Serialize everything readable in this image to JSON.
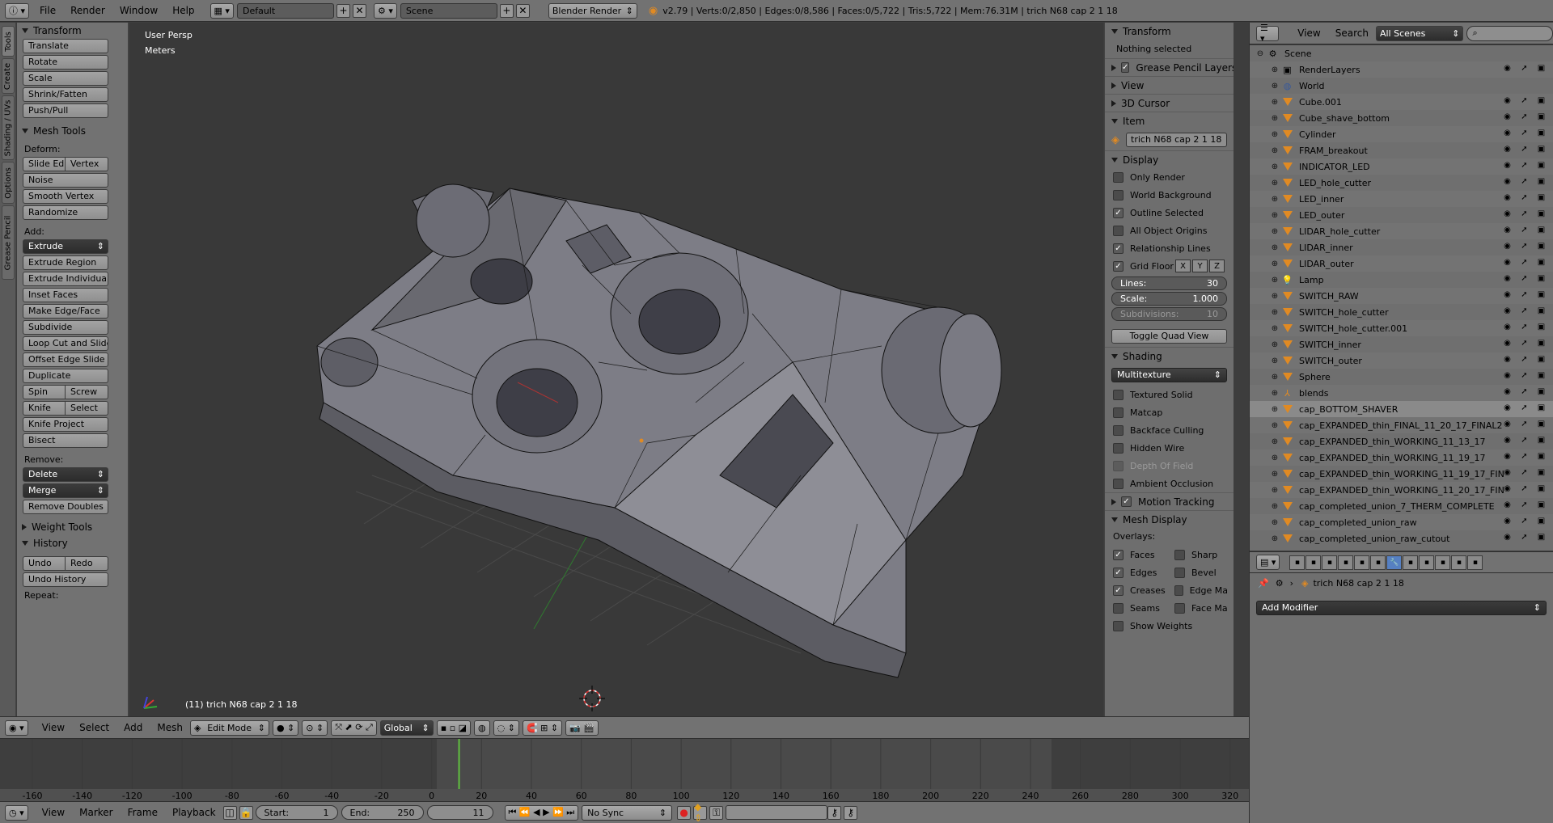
{
  "topbar": {
    "menus": [
      "File",
      "Render",
      "Window",
      "Help"
    ],
    "layout": "Default",
    "scene": "Scene",
    "engine": "Blender Render",
    "info": "v2.79 | Verts:0/2,850 | Edges:0/8,586 | Faces:0/5,722 | Tris:5,722 | Mem:76.31M | trich N68 cap 2 1 18"
  },
  "lefttabs": [
    "Tools",
    "Create",
    "Shading / UVs",
    "Options",
    "Grease Pencil"
  ],
  "toolshelf": {
    "transform_title": "Transform",
    "transform": [
      "Translate",
      "Rotate",
      "Scale",
      "Shrink/Fatten",
      "Push/Pull"
    ],
    "mesh_tools_title": "Mesh Tools",
    "deform_label": "Deform:",
    "deform_row": [
      "Slide Ed",
      "Vertex"
    ],
    "deform": [
      "Noise",
      "Smooth Vertex",
      "Randomize"
    ],
    "add_label": "Add:",
    "extrude": "Extrude",
    "add": [
      "Extrude Region",
      "Extrude Individual",
      "Inset Faces",
      "Make Edge/Face",
      "Subdivide",
      "Loop Cut and Slide",
      "Offset Edge Slide",
      "Duplicate"
    ],
    "spin_row": [
      "Spin",
      "Screw"
    ],
    "knife_row": [
      "Knife",
      "Select"
    ],
    "add2": [
      "Knife Project",
      "Bisect"
    ],
    "remove_label": "Remove:",
    "delete": "Delete",
    "merge": "Merge",
    "remove_doubles": "Remove Doubles",
    "weight_tools_title": "Weight Tools",
    "history_title": "History",
    "history_row": [
      "Undo",
      "Redo"
    ],
    "undo_history": "Undo History",
    "repeat_label": "Repeat:"
  },
  "viewport": {
    "view_name": "User Persp",
    "units": "Meters",
    "object_label": "(11) trich N68 cap 2 1 18"
  },
  "npanel": {
    "transform_title": "Transform",
    "nothing_selected": "Nothing selected",
    "grease_pencil": "Grease Pencil Layers",
    "view": "View",
    "cursor": "3D Cursor",
    "item": "Item",
    "item_name": "trich N68 cap 2 1 18",
    "display": "Display",
    "display_opts": [
      {
        "label": "Only Render",
        "on": false
      },
      {
        "label": "World Background",
        "on": false
      },
      {
        "label": "Outline Selected",
        "on": true
      },
      {
        "label": "All Object Origins",
        "on": false
      },
      {
        "label": "Relationship Lines",
        "on": true
      }
    ],
    "grid_floor": "Grid Floor",
    "axes": [
      "X",
      "Y",
      "Z"
    ],
    "lines_label": "Lines:",
    "lines_value": "30",
    "scale_label": "Scale:",
    "scale_value": "1.000",
    "subdiv_label": "Subdivisions:",
    "subdiv_value": "10",
    "toggle_quad": "Toggle Quad View",
    "shading": "Shading",
    "shading_mode": "Multitexture",
    "shading_opts": [
      {
        "label": "Textured Solid",
        "on": false
      },
      {
        "label": "Matcap",
        "on": false
      },
      {
        "label": "Backface Culling",
        "on": false
      },
      {
        "label": "Hidden Wire",
        "on": false
      },
      {
        "label": "Depth Of Field",
        "on": false,
        "dim": true
      },
      {
        "label": "Ambient Occlusion",
        "on": false
      }
    ],
    "motion_tracking": "Motion Tracking",
    "mesh_display": "Mesh Display",
    "overlays_label": "Overlays:",
    "overlays": [
      [
        {
          "label": "Faces",
          "on": true
        },
        {
          "label": "Sharp",
          "on": false
        }
      ],
      [
        {
          "label": "Edges",
          "on": true
        },
        {
          "label": "Bevel",
          "on": false
        }
      ],
      [
        {
          "label": "Creases",
          "on": true
        },
        {
          "label": "Edge Ma",
          "on": false
        }
      ],
      [
        {
          "label": "Seams",
          "on": false
        },
        {
          "label": "Face Ma",
          "on": false
        }
      ]
    ],
    "show_weights": "Show Weights"
  },
  "outliner": {
    "menus": [
      "View",
      "Search"
    ],
    "filter": "All Scenes",
    "rows": [
      {
        "name": "Scene",
        "icon": "scene-icon",
        "level": 0
      },
      {
        "name": "RenderLayers",
        "icon": "render-layers-icon",
        "level": 1
      },
      {
        "name": "World",
        "icon": "world-icon",
        "level": 1
      },
      {
        "name": "Cube.001",
        "icon": "mesh-object-icon",
        "level": 1
      },
      {
        "name": "Cube_shave_bottom",
        "icon": "mesh-object-icon",
        "level": 1
      },
      {
        "name": "Cylinder",
        "icon": "mesh-object-icon",
        "level": 1
      },
      {
        "name": "FRAM_breakout",
        "icon": "mesh-object-icon",
        "level": 1
      },
      {
        "name": "INDICATOR_LED",
        "icon": "mesh-object-icon",
        "level": 1
      },
      {
        "name": "LED_hole_cutter",
        "icon": "mesh-object-icon",
        "level": 1
      },
      {
        "name": "LED_inner",
        "icon": "mesh-object-icon",
        "level": 1
      },
      {
        "name": "LED_outer",
        "icon": "mesh-object-icon",
        "level": 1
      },
      {
        "name": "LIDAR_hole_cutter",
        "icon": "mesh-object-icon",
        "level": 1
      },
      {
        "name": "LIDAR_inner",
        "icon": "mesh-object-icon",
        "level": 1
      },
      {
        "name": "LIDAR_outer",
        "icon": "mesh-object-icon",
        "level": 1
      },
      {
        "name": "Lamp",
        "icon": "lamp-icon",
        "level": 1
      },
      {
        "name": "SWITCH_RAW",
        "icon": "mesh-object-icon",
        "level": 1
      },
      {
        "name": "SWITCH_hole_cutter",
        "icon": "mesh-object-icon",
        "level": 1
      },
      {
        "name": "SWITCH_hole_cutter.001",
        "icon": "mesh-object-icon",
        "level": 1
      },
      {
        "name": "SWITCH_inner",
        "icon": "mesh-object-icon",
        "level": 1
      },
      {
        "name": "SWITCH_outer",
        "icon": "mesh-object-icon",
        "level": 1
      },
      {
        "name": "Sphere",
        "icon": "mesh-object-icon",
        "level": 1
      },
      {
        "name": "blends",
        "icon": "empty-icon",
        "level": 1
      },
      {
        "name": "cap_BOTTOM_SHAVER",
        "icon": "mesh-object-icon",
        "level": 1,
        "selected": true
      },
      {
        "name": "cap_EXPANDED_thin_FINAL_11_20_17_FINAL2",
        "icon": "mesh-object-icon",
        "level": 1
      },
      {
        "name": "cap_EXPANDED_thin_WORKING_11_13_17",
        "icon": "mesh-object-icon",
        "level": 1
      },
      {
        "name": "cap_EXPANDED_thin_WORKING_11_19_17",
        "icon": "mesh-object-icon",
        "level": 1
      },
      {
        "name": "cap_EXPANDED_thin_WORKING_11_19_17_FIN",
        "icon": "mesh-object-icon",
        "level": 1
      },
      {
        "name": "cap_EXPANDED_thin_WORKING_11_20_17_FIN",
        "icon": "mesh-object-icon",
        "level": 1
      },
      {
        "name": "cap_completed_union_7_THERM_COMPLETE",
        "icon": "mesh-object-icon",
        "level": 1
      },
      {
        "name": "cap_completed_union_raw",
        "icon": "mesh-object-icon",
        "level": 1
      },
      {
        "name": "cap_completed_union_raw_cutout",
        "icon": "mesh-object-icon",
        "level": 1
      }
    ]
  },
  "properties": {
    "object_name": "trich N68 cap 2 1 18",
    "add_modifier": "Add Modifier"
  },
  "vp_header": {
    "menus": [
      "View",
      "Select",
      "Add",
      "Mesh"
    ],
    "mode": "Edit Mode",
    "orientation": "Global"
  },
  "timeline": {
    "ticks": [
      "-160",
      "-140",
      "-120",
      "-100",
      "-80",
      "-60",
      "-40",
      "-20",
      "0",
      "20",
      "40",
      "60",
      "80",
      "100",
      "120",
      "140",
      "160",
      "180",
      "200",
      "220",
      "240",
      "260",
      "280",
      "300",
      "320"
    ],
    "menus": [
      "View",
      "Marker",
      "Frame",
      "Playback"
    ],
    "start_label": "Start:",
    "start_value": "1",
    "end_label": "End:",
    "end_value": "250",
    "current_frame": "11",
    "sync": "No Sync"
  }
}
